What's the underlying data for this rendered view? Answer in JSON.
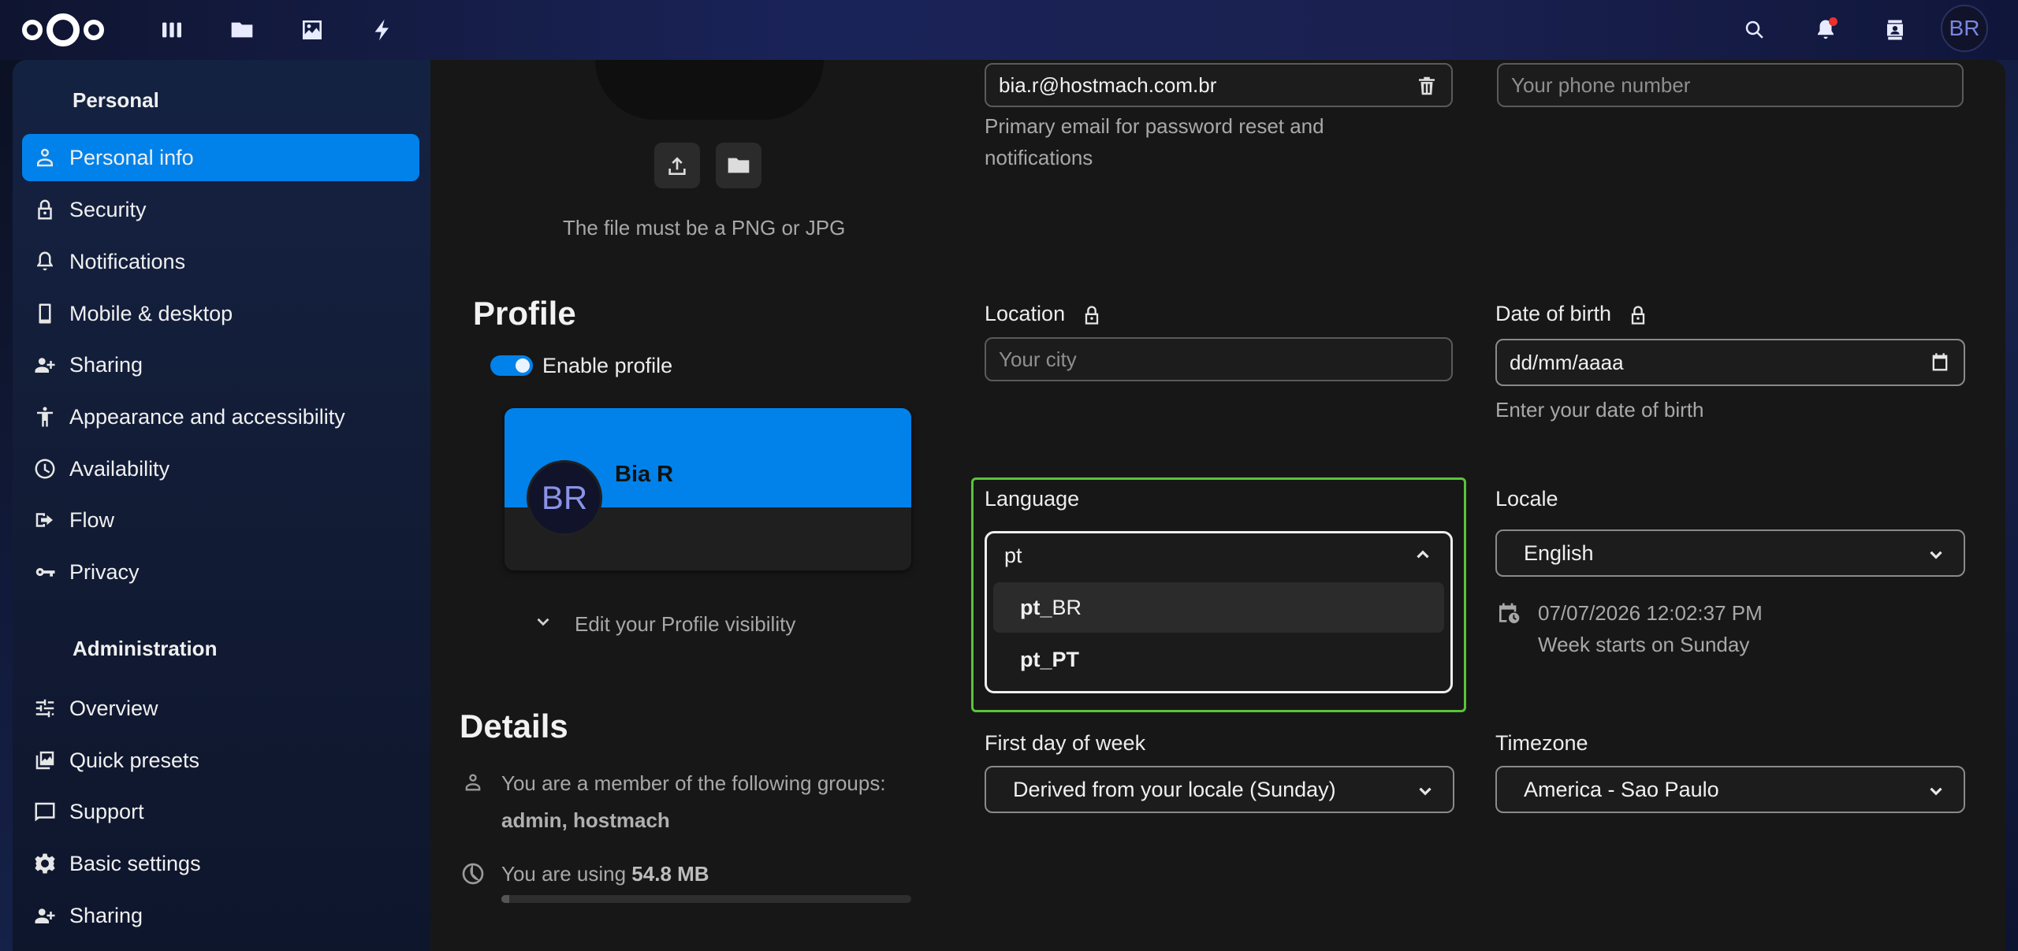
{
  "topbar": {
    "apps": [
      "dashboard-icon",
      "files-icon",
      "photos-icon",
      "activity-icon"
    ],
    "user_initials": "BR"
  },
  "sidebar": {
    "personal_heading": "Personal",
    "personal_items": [
      {
        "label": "Personal info",
        "icon": "person-icon",
        "active": true
      },
      {
        "label": "Security",
        "icon": "lock-icon"
      },
      {
        "label": "Notifications",
        "icon": "bell-icon"
      },
      {
        "label": "Mobile & desktop",
        "icon": "phone-icon"
      },
      {
        "label": "Sharing",
        "icon": "share-person-icon"
      },
      {
        "label": "Appearance and accessibility",
        "icon": "accessibility-icon"
      },
      {
        "label": "Availability",
        "icon": "clock-icon"
      },
      {
        "label": "Flow",
        "icon": "flow-icon"
      },
      {
        "label": "Privacy",
        "icon": "key-icon"
      }
    ],
    "admin_heading": "Administration",
    "admin_items": [
      {
        "label": "Overview",
        "icon": "sliders-icon"
      },
      {
        "label": "Quick presets",
        "icon": "presets-icon"
      },
      {
        "label": "Support",
        "icon": "chat-icon"
      },
      {
        "label": "Basic settings",
        "icon": "gear-icon"
      },
      {
        "label": "Sharing",
        "icon": "share-person-icon"
      }
    ]
  },
  "avatar_section": {
    "file_hint": "The file must be a PNG or JPG"
  },
  "profile": {
    "heading": "Profile",
    "enable_label": "Enable profile",
    "enabled": true,
    "card_initials": "BR",
    "card_name": "Bia R",
    "visibility_label": "Edit your Profile visibility"
  },
  "details": {
    "heading": "Details",
    "groups_text": "You are a member of the following groups:",
    "groups_value": "admin, hostmach",
    "usage_prefix": "You are using",
    "usage_value": "54.8 MB"
  },
  "email": {
    "value": "bia.r@hostmach.com.br",
    "hint_line1": "Primary email for password reset and",
    "hint_line2": "notifications"
  },
  "phone": {
    "placeholder": "Your phone number"
  },
  "location": {
    "label": "Location",
    "placeholder": "Your city"
  },
  "birth": {
    "label": "Date of birth",
    "value": "dd/mm/aaaa",
    "hint": "Enter your date of birth"
  },
  "language": {
    "label": "Language",
    "query": "pt",
    "options": [
      {
        "match": "pt_",
        "rest": "BR"
      },
      {
        "match": "pt_PT",
        "rest": ""
      }
    ]
  },
  "locale": {
    "label": "Locale",
    "value": "English",
    "datetime": "07/07/2026 12:02:37 PM",
    "week_start": "Week starts on Sunday"
  },
  "first_day": {
    "label": "First day of week",
    "value": "Derived from your locale (Sunday)"
  },
  "timezone": {
    "label": "Timezone",
    "value": "America - Sao Paulo"
  },
  "colors": {
    "accent": "#0082ea",
    "focus_highlight": "#5ac33a"
  }
}
